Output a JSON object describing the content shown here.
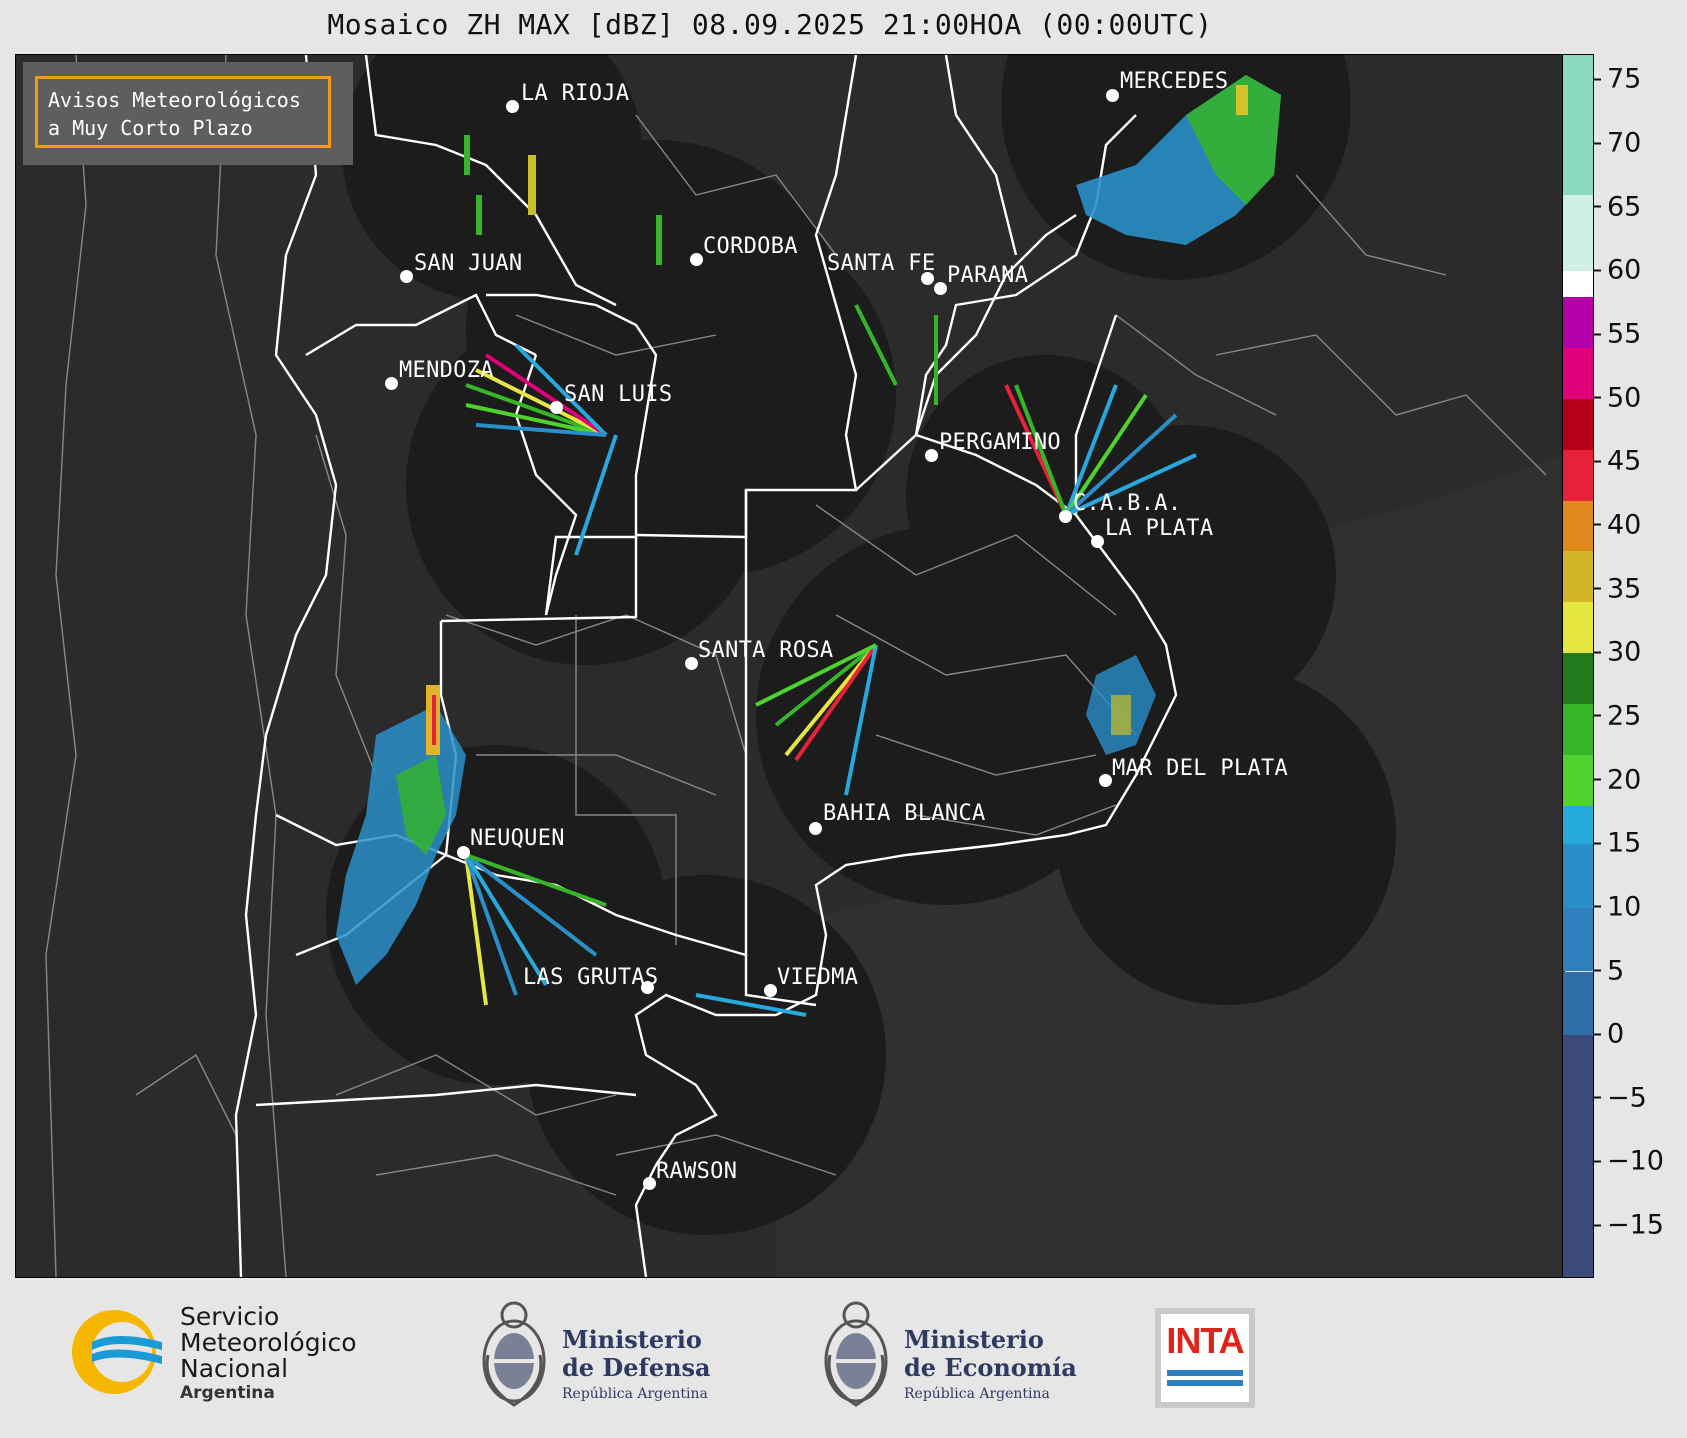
{
  "title": "Mosaico ZH MAX [dBZ] 08.09.2025 21:00HOA (00:00UTC)",
  "badge": {
    "line1": "Avisos Meteorológicos",
    "line2": "a Muy Corto Plazo",
    "border_color": "#f39c12"
  },
  "cities": [
    {
      "name": "LA RIOJA"
    },
    {
      "name": "SAN JUAN"
    },
    {
      "name": "CORDOBA"
    },
    {
      "name": "SANTA FE"
    },
    {
      "name": "PARANA"
    },
    {
      "name": "MERCEDES"
    },
    {
      "name": "MENDOZA"
    },
    {
      "name": "SAN LUIS"
    },
    {
      "name": "PERGAMINO"
    },
    {
      "name": "C.A.B.A."
    },
    {
      "name": "LA PLATA"
    },
    {
      "name": "SANTA ROSA"
    },
    {
      "name": "MAR DEL PLATA"
    },
    {
      "name": "BAHIA BLANCA"
    },
    {
      "name": "NEUQUEN"
    },
    {
      "name": "LAS GRUTAS"
    },
    {
      "name": "VIEDMA"
    },
    {
      "name": "RAWSON"
    }
  ],
  "colorbar": {
    "unit": "dBZ",
    "range": [
      -19,
      77
    ],
    "ticks": [
      "75",
      "70",
      "65",
      "60",
      "55",
      "50",
      "45",
      "40",
      "35",
      "30",
      "25",
      "20",
      "15",
      "10",
      "5",
      "0",
      "−5",
      "−10",
      "−15"
    ],
    "stops": [
      {
        "from": -19,
        "to": 0,
        "color": "#3b4a7a"
      },
      {
        "from": 0,
        "to": 5,
        "color": "#2f6ea8"
      },
      {
        "from": 5,
        "to": 10,
        "color": "#2f7fbd"
      },
      {
        "from": 10,
        "to": 15,
        "color": "#2a8fc9"
      },
      {
        "from": 15,
        "to": 18,
        "color": "#26a9dc"
      },
      {
        "from": 18,
        "to": 22,
        "color": "#4fd12e"
      },
      {
        "from": 22,
        "to": 26,
        "color": "#35b527"
      },
      {
        "from": 26,
        "to": 30,
        "color": "#227a1c"
      },
      {
        "from": 30,
        "to": 34,
        "color": "#e6e640"
      },
      {
        "from": 34,
        "to": 38,
        "color": "#d4b52a"
      },
      {
        "from": 38,
        "to": 42,
        "color": "#e08a1e"
      },
      {
        "from": 42,
        "to": 46,
        "color": "#e8203a"
      },
      {
        "from": 46,
        "to": 50,
        "color": "#b5001a"
      },
      {
        "from": 50,
        "to": 54,
        "color": "#e0007a"
      },
      {
        "from": 54,
        "to": 58,
        "color": "#b300a8"
      },
      {
        "from": 58,
        "to": 60,
        "color": "#ffffff"
      },
      {
        "from": 60,
        "to": 66,
        "color": "#cff0e4"
      },
      {
        "from": 66,
        "to": 77,
        "color": "#8ad9bd"
      }
    ]
  },
  "footer": {
    "smn": {
      "line1": "Servicio",
      "line2": "Meteorológico",
      "line3": "Nacional",
      "line4": "Argentina"
    },
    "defensa": {
      "line1": "Ministerio",
      "line2": "de Defensa",
      "line3": "República Argentina"
    },
    "economia": {
      "line1": "Ministerio",
      "line2": "de Economía",
      "line3": "República Argentina"
    },
    "inta": {
      "label": "INTA"
    }
  }
}
